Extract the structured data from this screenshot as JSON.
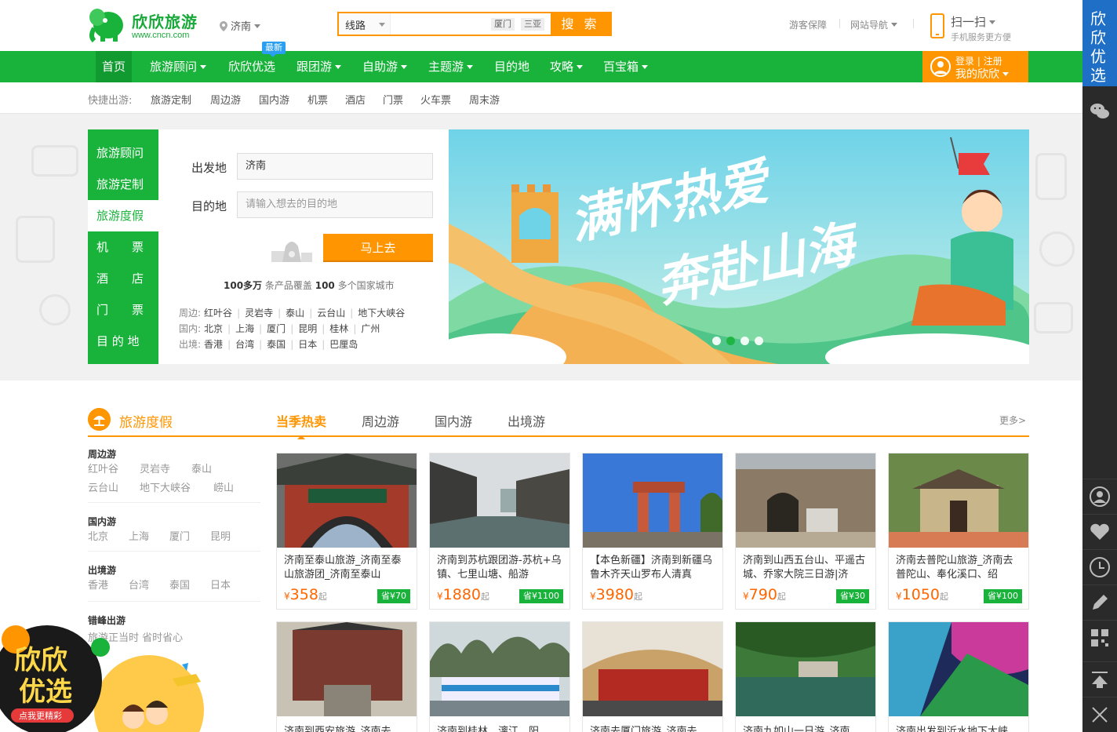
{
  "header": {
    "logo_text": "欣欣旅游",
    "logo_url": "www.cncn.com",
    "city": "济南",
    "search_type": "线路",
    "search_hot": [
      "厦门",
      "三亚"
    ],
    "search_button": "搜 索",
    "links": [
      "游客保障",
      "网站导航"
    ],
    "scan_title": "扫一扫",
    "scan_sub": "手机服务更方便"
  },
  "nav": {
    "items": [
      "首页",
      "旅游顾问",
      "欣欣优选",
      "跟团游",
      "自助游",
      "主题游",
      "目的地",
      "攻略",
      "百宝箱"
    ],
    "new_badge": "最新",
    "login": "登录",
    "register": "注册",
    "my": "我的欣欣"
  },
  "quick": {
    "label": "快捷出游:",
    "items": [
      "旅游定制",
      "周边游",
      "国内游",
      "机票",
      "酒店",
      "门票",
      "火车票",
      "周末游"
    ]
  },
  "side_menu": [
    "旅游顾问",
    "旅游定制",
    "旅游度假",
    "机　　票",
    "酒　　店",
    "门　　票",
    "目 的 地"
  ],
  "finder": {
    "from_label": "出发地",
    "from_value": "济南",
    "to_label": "目的地",
    "to_placeholder": "请输入想去的目的地",
    "go": "马上去",
    "stat1_num": "100多万",
    "stat1_text": "条产品覆盖",
    "stat2_num": "100",
    "stat2_text": "多个国家城市",
    "rows": [
      {
        "key": "周边:",
        "items": [
          "红叶谷",
          "灵岩寺",
          "泰山",
          "云台山",
          "地下大峡谷"
        ]
      },
      {
        "key": "国内:",
        "items": [
          "北京",
          "上海",
          "厦门",
          "昆明",
          "桂林",
          "广州"
        ]
      },
      {
        "key": "出境:",
        "items": [
          "香港",
          "台湾",
          "泰国",
          "日本",
          "巴厘岛"
        ]
      }
    ]
  },
  "banner": {
    "line1": "满怀热爱",
    "line2": "奔赴山海"
  },
  "section": {
    "title": "旅游度假",
    "tabs": [
      "当季热卖",
      "周边游",
      "国内游",
      "出境游"
    ],
    "more": "更多>",
    "categories": [
      {
        "title": "周边游",
        "links": [
          "红叶谷",
          "灵岩寺",
          "泰山",
          "云台山",
          "地下大峡谷",
          "崂山"
        ]
      },
      {
        "title": "国内游",
        "links": [
          "北京",
          "上海",
          "厦门",
          "昆明"
        ]
      },
      {
        "title": "出境游",
        "links": [
          "香港",
          "台湾",
          "泰国",
          "日本"
        ]
      },
      {
        "title": "错峰出游",
        "links": [
          "旅游正当时 省时省心"
        ]
      }
    ]
  },
  "products": [
    {
      "title": "济南至泰山旅游_济南至泰山旅游团_济南至泰山",
      "price": "358",
      "save": "省¥70"
    },
    {
      "title": "济南到苏杭跟团游-苏杭+乌镇、七里山塘、船游",
      "price": "1880",
      "save": "省¥1100"
    },
    {
      "title": "【本色新疆】济南到新疆乌鲁木齐天山罗布人清真",
      "price": "3980",
      "save": ""
    },
    {
      "title": "济南到山西五台山、平遥古城、乔家大院三日游|济",
      "price": "790",
      "save": "省¥30"
    },
    {
      "title": "济南去普陀山旅游_济南去普陀山、奉化溪口、绍",
      "price": "1050",
      "save": "省¥100"
    }
  ],
  "products2": [
    "济南到西安旅游_济南去",
    "济南到桂林、漓江、阳",
    "济南去厦门旅游_济南去",
    "济南九如山一日游_济南",
    "济南出发到沂水地下大峡"
  ],
  "price_unit": "¥",
  "price_suffix": "起",
  "rbar": {
    "promo_chars": [
      "欣",
      "欣",
      "优",
      "选"
    ]
  },
  "promo": {
    "line1": "欣欣",
    "line2": "优选",
    "tag": "点我更精彩"
  },
  "colors": {
    "green": "#19b33b",
    "orange": "#ff9500",
    "price": "#ff6600"
  }
}
